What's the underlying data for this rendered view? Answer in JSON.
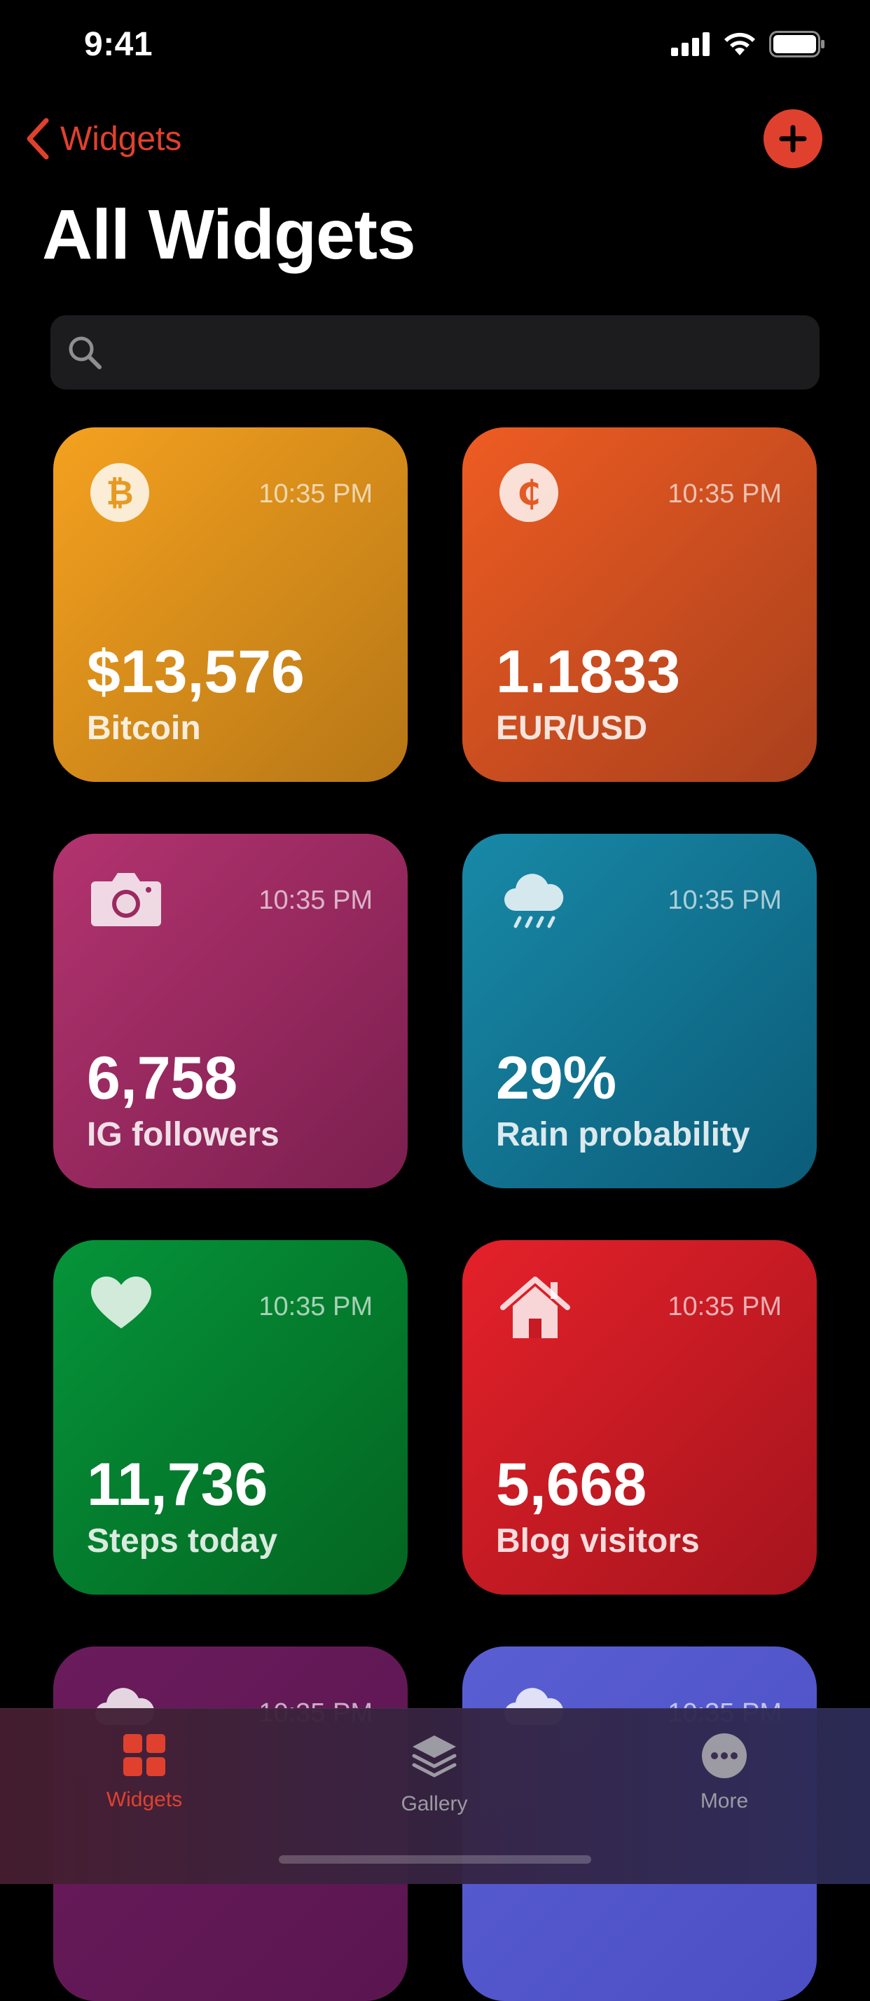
{
  "status": {
    "time": "9:41"
  },
  "nav": {
    "back_label": "Widgets"
  },
  "title": "All Widgets",
  "search": {
    "placeholder": ""
  },
  "widgets": [
    {
      "value": "$13,576",
      "label": "Bitcoin",
      "time": "10:35 PM",
      "icon": "bitcoin-icon",
      "color_from": "#f4a11f",
      "color_to": "#b77716"
    },
    {
      "value": "1.1833",
      "label": "EUR/USD",
      "time": "10:35 PM",
      "icon": "cedi-icon",
      "color_from": "#ee5c22",
      "color_to": "#a9401d"
    },
    {
      "value": "6,758",
      "label": "IG followers",
      "time": "10:35 PM",
      "icon": "camera-icon",
      "color_from": "#b3336f",
      "color_to": "#7b1f4f"
    },
    {
      "value": "29%",
      "label": "Rain probability",
      "time": "10:35 PM",
      "icon": "cloud-rain-icon",
      "color_from": "#1889a7",
      "color_to": "#0b5c79"
    },
    {
      "value": "11,736",
      "label": "Steps today",
      "time": "10:35 PM",
      "icon": "heart-icon",
      "color_from": "#05943a",
      "color_to": "#046521"
    },
    {
      "value": "5,668",
      "label": "Blog visitors",
      "time": "10:35 PM",
      "icon": "house-icon",
      "color_from": "#e5212a",
      "color_to": "#a5141d"
    },
    {
      "value": "",
      "label": "",
      "time": "10:35 PM",
      "icon": "cloud-icon",
      "color_from": "#6b1b5c",
      "color_to": "#5a1650"
    },
    {
      "value": "",
      "label": "",
      "time": "10:35 PM",
      "icon": "cloud-icon",
      "color_from": "#5a5ed3",
      "color_to": "#4b4fc3"
    }
  ],
  "tabs": [
    {
      "label": "Widgets",
      "icon": "grid-icon",
      "active": true
    },
    {
      "label": "Gallery",
      "icon": "layers-icon",
      "active": false
    },
    {
      "label": "More",
      "icon": "ellipsis-circle-icon",
      "active": false
    }
  ],
  "accent": "#e0412e"
}
